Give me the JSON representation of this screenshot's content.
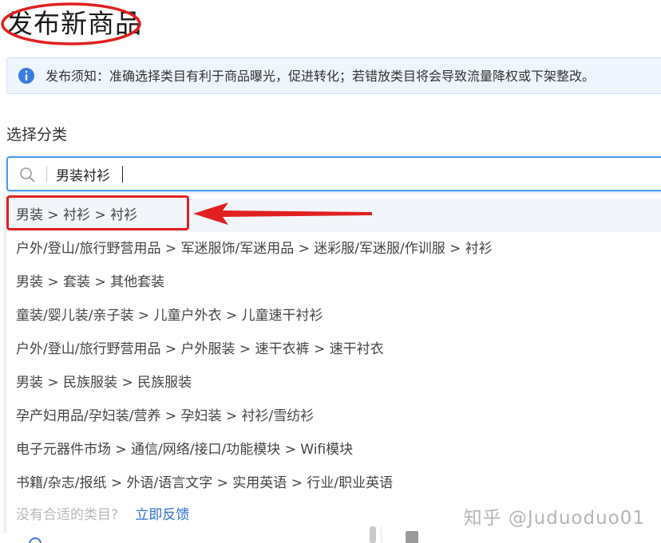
{
  "page_title": "发布新商品",
  "notice": {
    "text": "发布须知：准确选择类目有利于商品曝光，促进转化；若错放类目将会导致流量降权或下架整改。",
    "icon": "info-icon"
  },
  "category": {
    "label": "选择分类",
    "search": {
      "value": "男装衬衫",
      "icon": "search-icon"
    },
    "results": [
      "男装 > 衬衫 > 衬衫",
      "户外/登山/旅行野营用品 > 军迷服饰/军迷用品 > 迷彩服/军迷服/作训服 > 衬衫",
      "男装 > 套装 > 其他套装",
      "童装/婴儿装/亲子装 > 儿童户外衣 > 儿童速干衬衫",
      "户外/登山/旅行野营用品 > 户外服装 > 速干衣裤 > 速干衬衣",
      "男装 > 民族服装 > 民族服装",
      "孕产妇用品/孕妇装/营养 > 孕妇装 > 衬衫/雪纺衫",
      "电子元器件市场 > 通信/网络/接口/功能模块 > Wifi模块",
      "书籍/杂志/报纸 > 外语/语言文字 > 实用英语 > 行业/职业英语"
    ],
    "footer": {
      "hint": "没有合适的类目?",
      "link": "立即反馈"
    }
  },
  "watermark": "知乎 @Juduoduo01",
  "colors": {
    "annotation_red": "#e02020",
    "focus_blue": "#4d9bf0",
    "link_blue": "#2a6fd6",
    "notice_bg": "#eef5fd"
  }
}
